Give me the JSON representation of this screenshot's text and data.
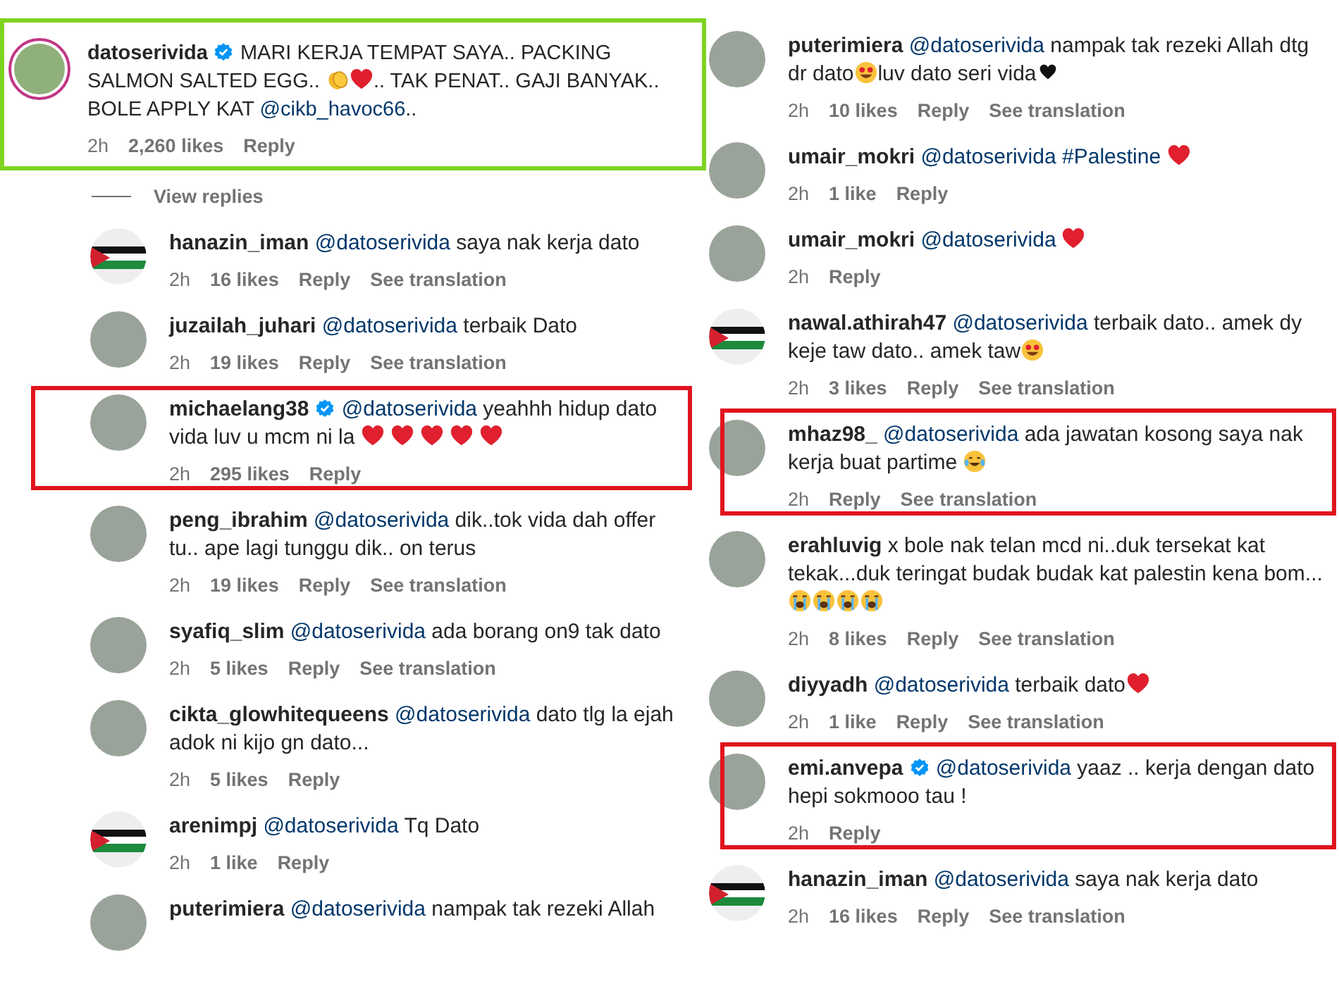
{
  "columns": [
    {
      "comments": [
        {
          "kind": "main",
          "avatar": {
            "kind": "photo"
          },
          "story_ring": true,
          "username": "datoserivida",
          "verified": true,
          "highlight": {
            "color": "#7ed321"
          },
          "body": [
            {
              "kind": "text",
              "text": "MARI KERJA TEMPAT SAYA.. PACKING SALMON SALTED EGG.. "
            },
            {
              "kind": "clap"
            },
            {
              "kind": "heart"
            },
            {
              "kind": "text",
              "text": ".. TAK PENAT.. GAJI BANYAK.. BOLE APPLY KAT "
            },
            {
              "kind": "mention",
              "text": "@cikb_havoc66"
            },
            {
              "kind": "text",
              "text": ".."
            }
          ],
          "meta": [
            {
              "kind": "time",
              "text": "2h"
            },
            {
              "kind": "likes",
              "text": "2,260 likes"
            },
            {
              "kind": "reply",
              "text": "Reply"
            }
          ],
          "view_replies": "View replies"
        },
        {
          "kind": "reply",
          "avatar": {
            "kind": "flag"
          },
          "story_ring": false,
          "username": "hanazin_iman",
          "verified": false,
          "body": [
            {
              "kind": "mention",
              "text": "@datoserivida"
            },
            {
              "kind": "text",
              "text": " saya nak kerja dato"
            }
          ],
          "meta": [
            {
              "kind": "time",
              "text": "2h"
            },
            {
              "kind": "likes",
              "text": "16 likes"
            },
            {
              "kind": "reply",
              "text": "Reply"
            },
            {
              "kind": "translate",
              "text": "See translation"
            }
          ]
        },
        {
          "kind": "reply",
          "avatar": {
            "kind": "photo"
          },
          "story_ring": false,
          "username": "juzailah_juhari",
          "verified": false,
          "body": [
            {
              "kind": "mention",
              "text": "@datoserivida"
            },
            {
              "kind": "text",
              "text": " terbaik Dato"
            }
          ],
          "meta": [
            {
              "kind": "time",
              "text": "2h"
            },
            {
              "kind": "likes",
              "text": "19 likes"
            },
            {
              "kind": "reply",
              "text": "Reply"
            },
            {
              "kind": "translate",
              "text": "See translation"
            }
          ]
        },
        {
          "kind": "reply",
          "avatar": {
            "kind": "photo"
          },
          "story_ring": false,
          "username": "michaelang38",
          "verified": true,
          "highlight": {
            "color": "#e0141e"
          },
          "body": [
            {
              "kind": "mention",
              "text": "@datoserivida"
            },
            {
              "kind": "text",
              "text": " yeahhh hidup dato vida luv u mcm ni la"
            },
            {
              "kind": "heart",
              "spaced": true
            },
            {
              "kind": "heart",
              "spaced": true
            },
            {
              "kind": "heart",
              "spaced": true
            },
            {
              "kind": "heart",
              "spaced": true
            },
            {
              "kind": "heart",
              "spaced": true
            }
          ],
          "meta": [
            {
              "kind": "time",
              "text": "2h"
            },
            {
              "kind": "likes",
              "text": "295 likes"
            },
            {
              "kind": "reply",
              "text": "Reply"
            }
          ]
        },
        {
          "kind": "reply",
          "avatar": {
            "kind": "photo"
          },
          "story_ring": false,
          "username": "peng_ibrahim",
          "verified": false,
          "body": [
            {
              "kind": "mention",
              "text": "@datoserivida"
            },
            {
              "kind": "text",
              "text": " dik..tok vida dah offer tu.. ape lagi tunggu dik.. on terus"
            }
          ],
          "meta": [
            {
              "kind": "time",
              "text": "2h"
            },
            {
              "kind": "likes",
              "text": "19 likes"
            },
            {
              "kind": "reply",
              "text": "Reply"
            },
            {
              "kind": "translate",
              "text": "See translation"
            }
          ]
        },
        {
          "kind": "reply",
          "avatar": {
            "kind": "photo"
          },
          "story_ring": false,
          "username": "syafiq_slim",
          "verified": false,
          "body": [
            {
              "kind": "mention",
              "text": "@datoserivida"
            },
            {
              "kind": "text",
              "text": " ada borang on9 tak dato"
            }
          ],
          "meta": [
            {
              "kind": "time",
              "text": "2h"
            },
            {
              "kind": "likes",
              "text": "5 likes"
            },
            {
              "kind": "reply",
              "text": "Reply"
            },
            {
              "kind": "translate",
              "text": "See translation"
            }
          ]
        },
        {
          "kind": "reply",
          "avatar": {
            "kind": "photo"
          },
          "story_ring": false,
          "username": "cikta_glowhitequeens",
          "verified": false,
          "body": [
            {
              "kind": "mention",
              "text": "@datoserivida"
            },
            {
              "kind": "text",
              "text": " dato tlg la ejah adok ni kijo gn dato..."
            }
          ],
          "meta": [
            {
              "kind": "time",
              "text": "2h"
            },
            {
              "kind": "likes",
              "text": "5 likes"
            },
            {
              "kind": "reply",
              "text": "Reply"
            }
          ]
        },
        {
          "kind": "reply",
          "avatar": {
            "kind": "flag"
          },
          "story_ring": false,
          "username": "arenimpj",
          "verified": false,
          "body": [
            {
              "kind": "mention",
              "text": "@datoserivida"
            },
            {
              "kind": "text",
              "text": " Tq Dato"
            }
          ],
          "meta": [
            {
              "kind": "time",
              "text": "2h"
            },
            {
              "kind": "likes",
              "text": "1 like"
            },
            {
              "kind": "reply",
              "text": "Reply"
            }
          ]
        },
        {
          "kind": "reply",
          "avatar": {
            "kind": "photo"
          },
          "story_ring": false,
          "username": "puterimiera",
          "verified": false,
          "body": [
            {
              "kind": "mention",
              "text": "@datoserivida"
            },
            {
              "kind": "text",
              "text": " nampak tak rezeki Allah"
            }
          ]
        }
      ]
    },
    {
      "comments": [
        {
          "kind": "reply",
          "avatar": {
            "kind": "photo"
          },
          "story_ring": false,
          "username": "puterimiera",
          "verified": false,
          "body": [
            {
              "kind": "mention",
              "text": "@datoserivida"
            },
            {
              "kind": "text",
              "text": " nampak tak rezeki Allah dtg dr dato"
            },
            {
              "kind": "starstruck"
            },
            {
              "kind": "text",
              "text": "luv dato seri vida"
            },
            {
              "kind": "black-heart"
            }
          ],
          "meta": [
            {
              "kind": "time",
              "text": "2h"
            },
            {
              "kind": "likes",
              "text": "10 likes"
            },
            {
              "kind": "reply",
              "text": "Reply"
            },
            {
              "kind": "translate",
              "text": "See translation"
            }
          ]
        },
        {
          "kind": "reply",
          "avatar": {
            "kind": "photo"
          },
          "story_ring": false,
          "username": "umair_mokri",
          "verified": false,
          "body": [
            {
              "kind": "mention",
              "text": "@datoserivida"
            },
            {
              "kind": "mention",
              "text": "#Palestine"
            },
            {
              "kind": "heart"
            }
          ],
          "meta": [
            {
              "kind": "time",
              "text": "2h"
            },
            {
              "kind": "likes",
              "text": "1 like"
            },
            {
              "kind": "reply",
              "text": "Reply"
            }
          ]
        },
        {
          "kind": "reply",
          "avatar": {
            "kind": "photo"
          },
          "story_ring": false,
          "username": "umair_mokri",
          "verified": false,
          "body": [
            {
              "kind": "mention",
              "text": "@datoserivida"
            },
            {
              "kind": "heart"
            }
          ],
          "meta": [
            {
              "kind": "time",
              "text": "2h"
            },
            {
              "kind": "reply",
              "text": "Reply"
            }
          ]
        },
        {
          "kind": "reply",
          "avatar": {
            "kind": "flag"
          },
          "story_ring": false,
          "username": "nawal.athirah47",
          "verified": false,
          "body": [
            {
              "kind": "mention",
              "text": "@datoserivida"
            },
            {
              "kind": "text",
              "text": " terbaik dato.. amek dy keje taw dato.. amek taw"
            },
            {
              "kind": "starstruck"
            }
          ],
          "meta": [
            {
              "kind": "time",
              "text": "2h"
            },
            {
              "kind": "likes",
              "text": "3 likes"
            },
            {
              "kind": "reply",
              "text": "Reply"
            },
            {
              "kind": "translate",
              "text": "See translation"
            }
          ]
        },
        {
          "kind": "reply",
          "avatar": {
            "kind": "photo"
          },
          "story_ring": false,
          "username": "mhaz98_",
          "verified": false,
          "highlight": {
            "color": "#e0141e"
          },
          "body": [
            {
              "kind": "mention",
              "text": "@datoserivida"
            },
            {
              "kind": "text",
              "text": " ada jawatan kosong saya nak kerja buat partime "
            },
            {
              "kind": "laugh-cry"
            }
          ],
          "meta": [
            {
              "kind": "time",
              "text": "2h"
            },
            {
              "kind": "reply",
              "text": "Reply"
            },
            {
              "kind": "translate",
              "text": "See translation"
            }
          ]
        },
        {
          "kind": "reply",
          "avatar": {
            "kind": "photo"
          },
          "story_ring": false,
          "username": "erahluvig",
          "verified": false,
          "body": [
            {
              "kind": "text",
              "text": " x bole nak telan mcd ni..duk tersekat kat tekak...duk teringat budak budak kat palestin kena bom..."
            },
            {
              "kind": "sob"
            },
            {
              "kind": "sob"
            },
            {
              "kind": "sob"
            },
            {
              "kind": "sob"
            }
          ],
          "meta": [
            {
              "kind": "time",
              "text": "2h"
            },
            {
              "kind": "likes",
              "text": "8 likes"
            },
            {
              "kind": "reply",
              "text": "Reply"
            },
            {
              "kind": "translate",
              "text": "See translation"
            }
          ]
        },
        {
          "kind": "reply",
          "avatar": {
            "kind": "photo"
          },
          "story_ring": false,
          "username": "diyyadh",
          "verified": false,
          "body": [
            {
              "kind": "mention",
              "text": "@datoserivida"
            },
            {
              "kind": "text",
              "text": " terbaik dato"
            },
            {
              "kind": "heart"
            }
          ],
          "meta": [
            {
              "kind": "time",
              "text": "2h"
            },
            {
              "kind": "likes",
              "text": "1 like"
            },
            {
              "kind": "reply",
              "text": "Reply"
            },
            {
              "kind": "translate",
              "text": "See translation"
            }
          ]
        },
        {
          "kind": "reply",
          "avatar": {
            "kind": "photo"
          },
          "story_ring": false,
          "username": "emi.anvepa",
          "verified": true,
          "highlight": {
            "color": "#e0141e"
          },
          "body": [
            {
              "kind": "mention",
              "text": "@datoserivida"
            },
            {
              "kind": "text",
              "text": " yaaz .. kerja dengan dato hepi sokmooo tau !"
            }
          ],
          "meta": [
            {
              "kind": "time",
              "text": "2h"
            },
            {
              "kind": "reply",
              "text": "Reply"
            }
          ]
        },
        {
          "kind": "reply",
          "avatar": {
            "kind": "flag"
          },
          "story_ring": false,
          "username": "hanazin_iman",
          "verified": false,
          "body": [
            {
              "kind": "mention",
              "text": "@datoserivida"
            },
            {
              "kind": "text",
              "text": " saya nak kerja dato"
            }
          ],
          "meta": [
            {
              "kind": "time",
              "text": "2h"
            },
            {
              "kind": "likes",
              "text": "16 likes"
            },
            {
              "kind": "reply",
              "text": "Reply"
            },
            {
              "kind": "translate",
              "text": "See translation"
            }
          ]
        }
      ]
    }
  ]
}
